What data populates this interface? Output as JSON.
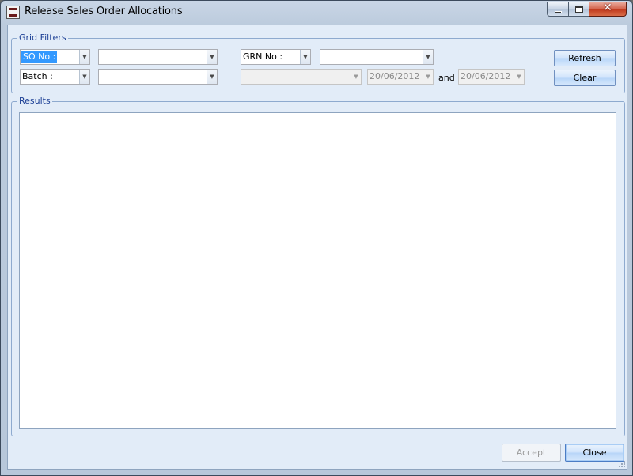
{
  "window": {
    "title": "Release Sales Order Allocations",
    "controls": {
      "minimize": "minimize",
      "maximize": "maximize",
      "close": "✕"
    }
  },
  "filters": {
    "group_label": "Grid Filters",
    "field1_selector": "SO No :",
    "field1_value": "",
    "field2_selector": "Batch :",
    "field2_value": "",
    "field3_selector": "GRN No :",
    "field3_value": "",
    "date_field_selector": "",
    "date_from": "20/06/2012",
    "and_label": "and",
    "date_to": "20/06/2012",
    "refresh_label": "Refresh",
    "clear_label": "Clear"
  },
  "results": {
    "group_label": "Results"
  },
  "footer": {
    "accept_label": "Accept",
    "close_label": "Close"
  },
  "colors": {
    "accent": "#1c3f95",
    "selection": "#3399ff",
    "client_bg": "#e2ecf8"
  }
}
